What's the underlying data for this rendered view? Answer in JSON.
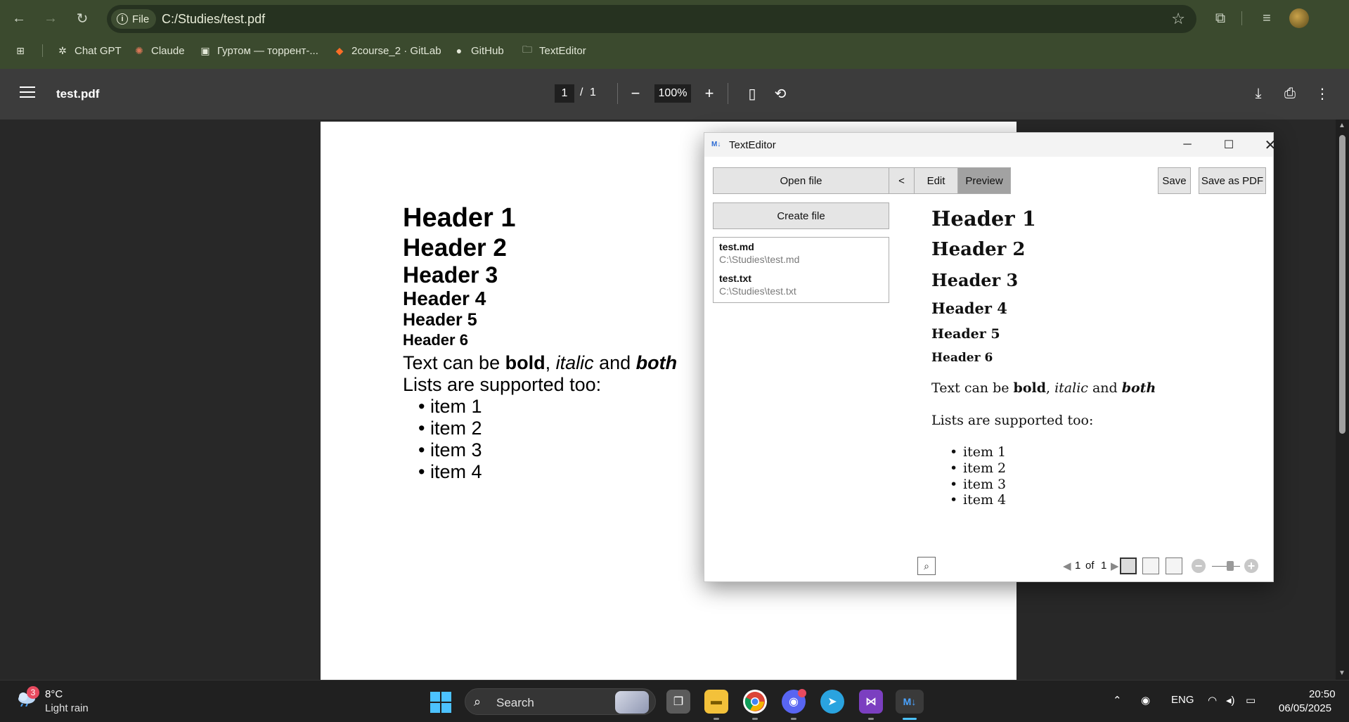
{
  "browser": {
    "url_chip": "File",
    "url": "C:/Studies/test.pdf",
    "bookmarks": [
      {
        "label": "Chat GPT",
        "icon": "chatgpt-icon"
      },
      {
        "label": "Claude",
        "icon": "claude-icon"
      },
      {
        "label": "Гуртом — торрент-...",
        "icon": "hurtom-icon"
      },
      {
        "label": "2course_2 · GitLab",
        "icon": "gitlab-icon"
      },
      {
        "label": "GitHub",
        "icon": "github-icon"
      },
      {
        "label": "TextEditor",
        "icon": "folder-icon"
      }
    ]
  },
  "pdf_viewer": {
    "file_title": "test.pdf",
    "current_page": "1",
    "page_sep": "/",
    "total_pages": "1",
    "zoom": "100%",
    "content": {
      "headers": [
        "Header 1",
        "Header 2",
        "Header 3",
        "Header 4",
        "Header 5",
        "Header 6"
      ],
      "text_prefix": "Text can be ",
      "bold": "bold",
      "comma": ", ",
      "italic": "italic",
      "and": " and ",
      "both": "both",
      "lists_line": "Lists are supported too:",
      "items": [
        "item 1",
        "item 2",
        "item 3",
        "item 4"
      ]
    }
  },
  "text_editor": {
    "title": "TextEditor",
    "logo": "M↓",
    "buttons": {
      "open_file": "Open file",
      "back": "<",
      "edit": "Edit",
      "preview": "Preview",
      "save": "Save",
      "save_pdf": "Save as PDF",
      "create_file": "Create file"
    },
    "files": [
      {
        "name": "test.md",
        "path": "C:\\Studies\\test.md"
      },
      {
        "name": "test.txt",
        "path": "C:\\Studies\\test.txt"
      }
    ],
    "preview": {
      "headers": [
        "Header 1",
        "Header 2",
        "Header 3",
        "Header 4",
        "Header 5",
        "Header 6"
      ],
      "text_prefix": "Text can be ",
      "bold": "bold",
      "comma": ", ",
      "italic": "italic",
      "and": " and ",
      "both": "both",
      "lists_line": "Lists are supported too:",
      "items": [
        "item 1",
        "item 2",
        "item 3",
        "item 4"
      ]
    },
    "status": {
      "page": "1",
      "of": "of",
      "total": "1"
    }
  },
  "taskbar": {
    "weather_badge": "3",
    "temperature": "8°C",
    "weather": "Light rain",
    "search_placeholder": "Search",
    "language": "ENG",
    "time": "20:50",
    "date": "06/05/2025",
    "apps": [
      "file-explorer",
      "chrome",
      "discord",
      "telegram",
      "visual-studio",
      "markdown-editor"
    ]
  },
  "colors": {
    "browser_frame": "#3b4a2e",
    "pdf_toolbar": "#3c3c3c",
    "pdf_background": "#282828",
    "preview_active": "#a2a2a2",
    "windows_accent": "#4cc2ff"
  }
}
